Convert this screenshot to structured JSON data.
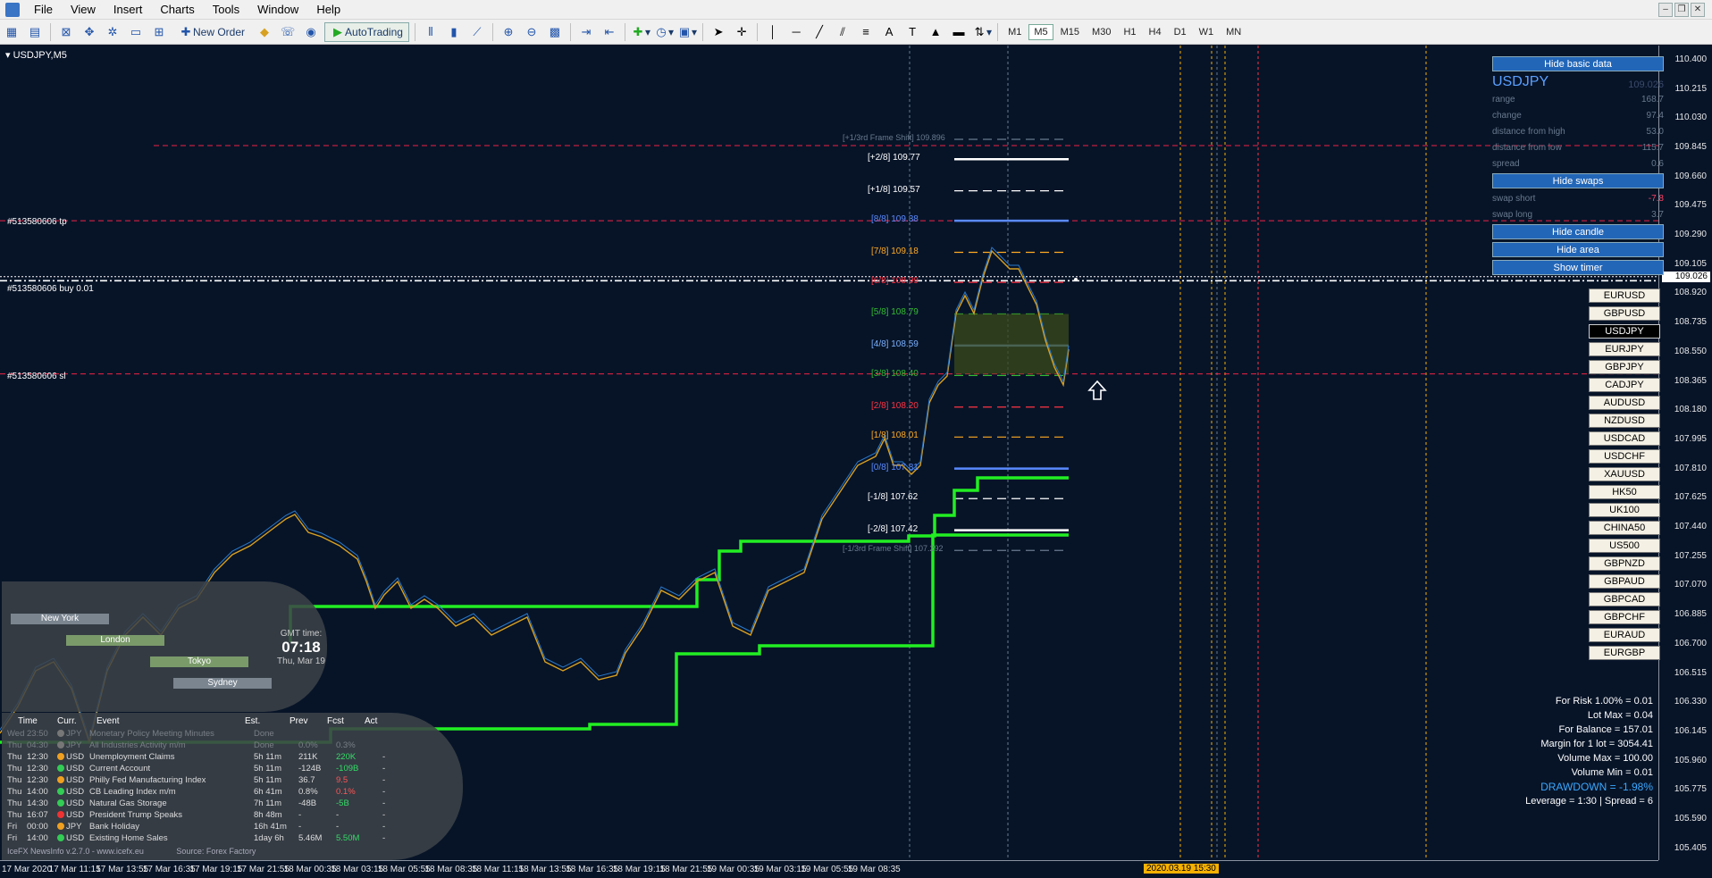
{
  "menu": [
    "File",
    "View",
    "Insert",
    "Charts",
    "Tools",
    "Window",
    "Help"
  ],
  "toolbar": {
    "new_order": "New Order",
    "autotrading": "AutoTrading",
    "timeframes": [
      "M1",
      "M5",
      "M15",
      "M30",
      "H1",
      "H4",
      "D1",
      "W1",
      "MN"
    ],
    "active_timeframe": "M5"
  },
  "chart": {
    "title": "USDJPY,M5",
    "price_ticks": [
      "110.400",
      "110.215",
      "110.030",
      "109.845",
      "109.660",
      "109.475",
      "109.290",
      "109.105",
      "108.920",
      "108.735",
      "108.550",
      "108.365",
      "108.180",
      "107.995",
      "107.810",
      "107.625",
      "107.440",
      "107.255",
      "107.070",
      "106.885",
      "106.700",
      "106.515",
      "106.330",
      "106.145",
      "105.960",
      "105.775",
      "105.590",
      "105.405"
    ],
    "current_price": "109.026",
    "time_ticks": [
      "17 Mar 2020",
      "17 Mar 11:15",
      "17 Mar 13:55",
      "17 Mar 16:35",
      "17 Mar 19:15",
      "17 Mar 21:55",
      "18 Mar 00:35",
      "18 Mar 03:15",
      "18 Mar 05:55",
      "18 Mar 08:35",
      "18 Mar 11:15",
      "18 Mar 13:55",
      "18 Mar 16:35",
      "18 Mar 19:15",
      "18 Mar 21:55",
      "19 Mar 00:35",
      "19 Mar 03:15",
      "19 Mar 05:55",
      "19 Mar 08:35"
    ],
    "time_highlight": "2020.03.19 15:30",
    "order_labels": {
      "tp": "#513580606 tp",
      "buy": "#513580606 buy 0.01",
      "sl": "#513580606 sl"
    },
    "fib_levels": [
      {
        "label": "[+1/3rd Frame Shift]",
        "price": "109.896",
        "color": "#6a7a8e"
      },
      {
        "label": "[+2/8]",
        "price": "109.77",
        "color": "#ffffff"
      },
      {
        "label": "[+1/8]",
        "price": "109.57",
        "color": "#ffffff"
      },
      {
        "label": "[8/8]",
        "price": "109.38",
        "color": "#5a8aff"
      },
      {
        "label": "[7/8]",
        "price": "109.18",
        "color": "#ffaa22"
      },
      {
        "label": "[6/8]",
        "price": "108.99",
        "color": "#ff3344"
      },
      {
        "label": "[5/8]",
        "price": "108.79",
        "color": "#33bb33"
      },
      {
        "label": "[4/8]",
        "price": "108.59",
        "color": "#7ab0ff"
      },
      {
        "label": "[3/8]",
        "price": "108.40",
        "color": "#33bb33"
      },
      {
        "label": "[2/8]",
        "price": "108.20",
        "color": "#ff3344"
      },
      {
        "label": "[1/8]",
        "price": "108.01",
        "color": "#ffaa22"
      },
      {
        "label": "[0/8]",
        "price": "107.81",
        "color": "#5a8aff"
      },
      {
        "label": "[-1/8]",
        "price": "107.62",
        "color": "#ffffff"
      },
      {
        "label": "[-2/8]",
        "price": "107.42",
        "color": "#ffffff"
      },
      {
        "label": "[-1/3rd Frame Shift]",
        "price": "107.292",
        "color": "#6a7a8e"
      }
    ]
  },
  "info_panel": {
    "hide_basic_data": "Hide basic data",
    "symbol": "USDJPY",
    "symbol_price": "109.026",
    "rows": [
      {
        "k": "range",
        "v": "168.7"
      },
      {
        "k": "change",
        "v": "97.4"
      },
      {
        "k": "distance from high",
        "v": "53.0"
      },
      {
        "k": "distance from low",
        "v": "115.7"
      },
      {
        "k": "spread",
        "v": "0.6"
      }
    ],
    "hide_swaps": "Hide swaps",
    "swap_rows": [
      {
        "k": "swap short",
        "v": "-7.8",
        "red": true
      },
      {
        "k": "swap long",
        "v": "3.7",
        "red": false
      }
    ],
    "hide_candle": "Hide candle",
    "hide_area": "Hide area",
    "show_timer": "Show timer"
  },
  "symbol_buttons": [
    "EURUSD",
    "GBPUSD",
    "USDJPY",
    "EURJPY",
    "GBPJPY",
    "CADJPY",
    "AUDUSD",
    "NZDUSD",
    "USDCAD",
    "USDCHF",
    "XAUUSD",
    "HK50",
    "UK100",
    "CHINA50",
    "US500",
    "GBPNZD",
    "GBPAUD",
    "GBPCAD",
    "GBPCHF",
    "EURAUD",
    "EURGBP"
  ],
  "active_symbol": "USDJPY",
  "risk_panel": [
    "For Risk 1.00% = 0.01",
    "Lot Max = 0.04",
    "For Balance = 157.01",
    "Margin for 1 lot = 3054.41",
    "Volume Max = 100.00",
    "Volume Min = 0.01",
    "DRAWDOWN = -1.98%",
    "Leverage = 1:30 | Spread = 6"
  ],
  "sessions": {
    "new_york": "New York",
    "london": "London",
    "tokyo": "Tokyo",
    "sydney": "Sydney",
    "gmt_label": "GMT time:",
    "gmt_time": "07:18",
    "gmt_date": "Thu, Mar 19"
  },
  "news": {
    "headers": {
      "time": "Time",
      "curr": "Curr.",
      "event": "Event",
      "est": "Est.",
      "prev": "Prev",
      "fcst": "Fcst",
      "act": "Act"
    },
    "rows": [
      {
        "day": "Wed",
        "time": "23:50",
        "cur": "JPY",
        "event": "Monetary Policy Meeting Minutes",
        "est": "Done",
        "prev": "",
        "fcst": "",
        "act": "",
        "past": true,
        "dot": "#777777",
        "fc": ""
      },
      {
        "day": "Thu",
        "time": "04:30",
        "cur": "JPY",
        "event": "All Industries Activity m/m",
        "est": "Done",
        "prev": "0.0%",
        "fcst": "0.3%",
        "act": "",
        "past": true,
        "dot": "#777777",
        "fc": ""
      },
      {
        "day": "Thu",
        "time": "12:30",
        "cur": "USD",
        "event": "Unemployment Claims",
        "est": "5h 11m",
        "prev": "211K",
        "fcst": "220K",
        "act": "-",
        "past": false,
        "dot": "#f0a020",
        "fc": "green"
      },
      {
        "day": "Thu",
        "time": "12:30",
        "cur": "USD",
        "event": "Current Account",
        "est": "5h 11m",
        "prev": "-124B",
        "fcst": "-109B",
        "act": "-",
        "past": false,
        "dot": "#33cc55",
        "fc": "green"
      },
      {
        "day": "Thu",
        "time": "12:30",
        "cur": "USD",
        "event": "Philly Fed Manufacturing Index",
        "est": "5h 11m",
        "prev": "36.7",
        "fcst": "9.5",
        "act": "-",
        "past": false,
        "dot": "#f0a020",
        "fc": "red"
      },
      {
        "day": "Thu",
        "time": "14:00",
        "cur": "USD",
        "event": "CB Leading Index m/m",
        "est": "6h 41m",
        "prev": "0.8%",
        "fcst": "0.1%",
        "act": "-",
        "past": false,
        "dot": "#33cc55",
        "fc": "red"
      },
      {
        "day": "Thu",
        "time": "14:30",
        "cur": "USD",
        "event": "Natural Gas Storage",
        "est": "7h 11m",
        "prev": "-48B",
        "fcst": "-5B",
        "act": "-",
        "past": false,
        "dot": "#33cc55",
        "fc": "green"
      },
      {
        "day": "Thu",
        "time": "16:07",
        "cur": "USD",
        "event": "President Trump Speaks",
        "est": "8h 48m",
        "prev": "-",
        "fcst": "-",
        "act": "-",
        "past": false,
        "dot": "#ee3333",
        "fc": ""
      },
      {
        "day": "Fri",
        "time": "00:00",
        "cur": "JPY",
        "event": "Bank Holiday",
        "est": "16h 41m",
        "prev": "-",
        "fcst": "-",
        "act": "-",
        "past": false,
        "dot": "#f0a020",
        "fc": ""
      },
      {
        "day": "Fri",
        "time": "14:00",
        "cur": "USD",
        "event": "Existing Home Sales",
        "est": "1day 6h",
        "prev": "5.46M",
        "fcst": "5.50M",
        "act": "-",
        "past": false,
        "dot": "#33cc55",
        "fc": "green"
      }
    ],
    "footer_left": "IceFX NewsInfo v.2.7.0 - www.icefx.eu",
    "footer_right": "Source: Forex Factory"
  }
}
